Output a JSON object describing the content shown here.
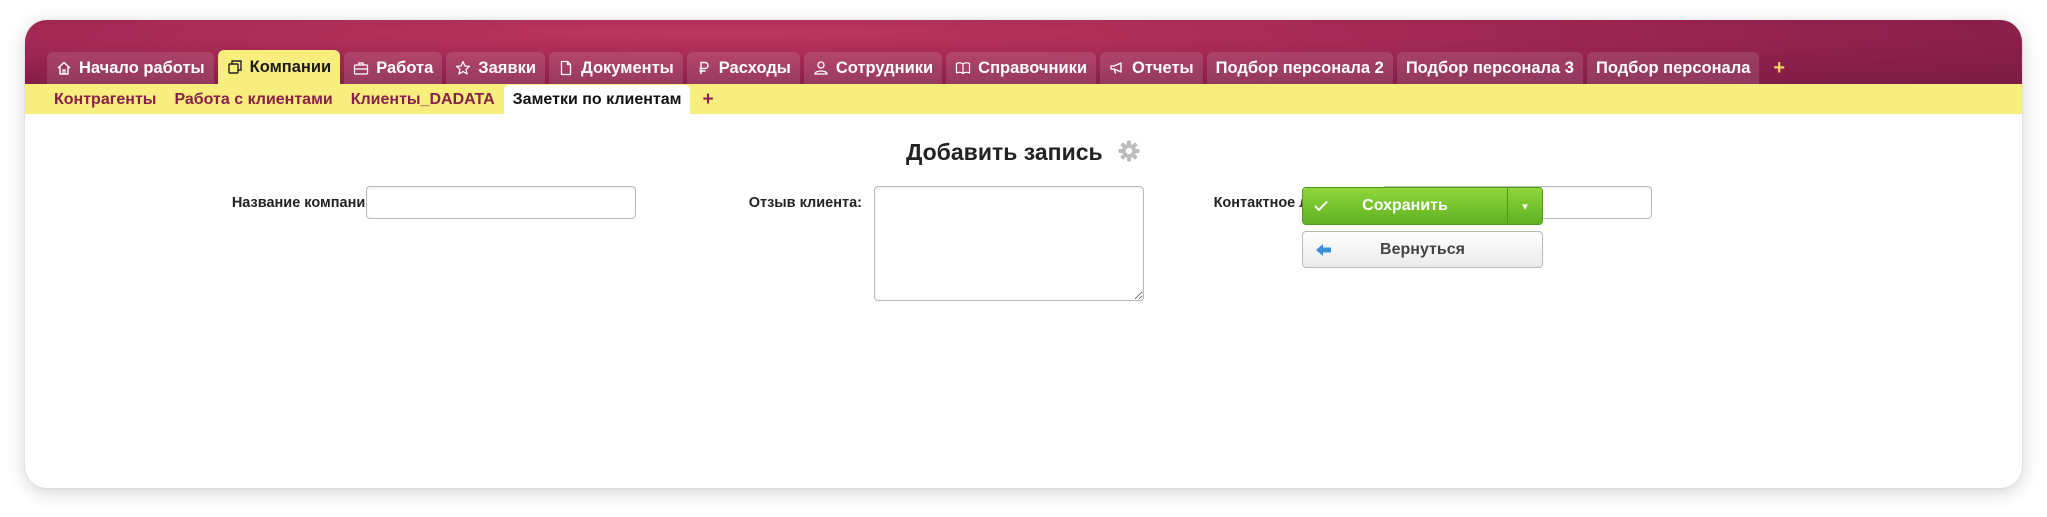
{
  "tabs": [
    {
      "label": "Начало работы",
      "icon": "home-icon",
      "active": false
    },
    {
      "label": "Компании",
      "icon": "copy-icon",
      "active": true
    },
    {
      "label": "Работа",
      "icon": "briefcase-icon",
      "active": false
    },
    {
      "label": "Заявки",
      "icon": "star-icon",
      "active": false
    },
    {
      "label": "Документы",
      "icon": "document-icon",
      "active": false
    },
    {
      "label": "Расходы",
      "icon": "ruble-icon",
      "active": false
    },
    {
      "label": "Сотрудники",
      "icon": "users-icon",
      "active": false
    },
    {
      "label": "Справочники",
      "icon": "book-icon",
      "active": false
    },
    {
      "label": "Отчеты",
      "icon": "megaphone-icon",
      "active": false
    },
    {
      "label": "Подбор персонала 2",
      "icon": "",
      "active": false
    },
    {
      "label": "Подбор персонала 3",
      "icon": "",
      "active": false
    },
    {
      "label": "Подбор персонала",
      "icon": "",
      "active": false
    }
  ],
  "tab_add": "+",
  "subtabs": [
    {
      "label": "Контрагенты",
      "active": false
    },
    {
      "label": "Работа с клиентами",
      "active": false
    },
    {
      "label": "Клиенты_DADATA",
      "active": false
    },
    {
      "label": "Заметки по клиентам",
      "active": true
    }
  ],
  "subtab_add": "+",
  "form": {
    "title": "Добавить запись",
    "company_label": "Название компании:",
    "company_value": "",
    "review_label": "Отзыв клиента:",
    "review_value": "",
    "contact_label": "Контактное лицо:",
    "contact_value": ""
  },
  "buttons": {
    "save": "Сохранить",
    "caret": "▾",
    "back": "Вернуться"
  },
  "colors": {
    "header": "#a52a55",
    "subbar": "#f7ee7e",
    "subtab_text": "#8a1f4a",
    "save_green": "#6cbf27"
  }
}
